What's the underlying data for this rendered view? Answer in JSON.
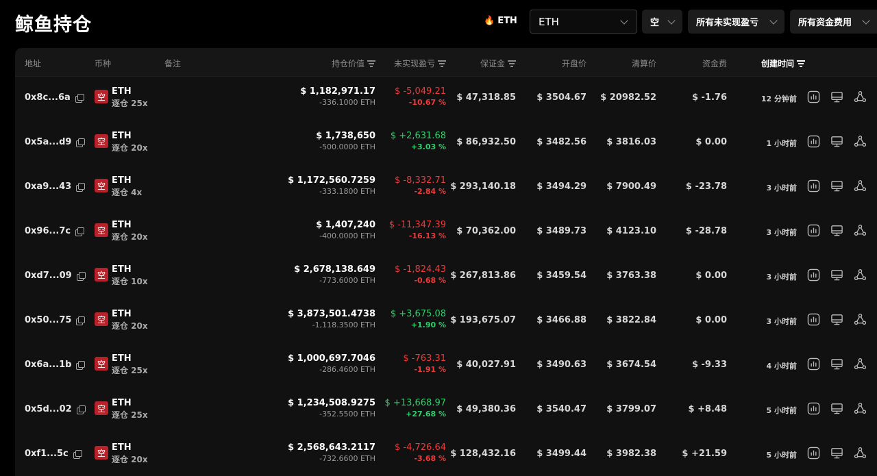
{
  "header": {
    "title": "鲸鱼持仓",
    "hot_label": "ETH",
    "coin_select_value": "ETH",
    "direction_filter": "空",
    "pnl_filter": "所有未实现盈亏",
    "funding_filter": "所有资金费用"
  },
  "columns": {
    "address": "地址",
    "coin": "币种",
    "note": "备注",
    "position_value": "持仓价值",
    "unrealized_pnl": "未实现盈亏",
    "margin": "保证金",
    "open_price": "开盘价",
    "liq_price": "清算价",
    "funding": "资金费",
    "created": "创建时间"
  },
  "side_badge": "空",
  "rows": [
    {
      "address": "0x8c...6a",
      "coin": "ETH",
      "leverage": "逐仓 25x",
      "value": "$ 1,182,971.17",
      "size": "-336.1000 ETH",
      "pnl": "$ -5,049.21",
      "pnl_pct": "-10.67 %",
      "pnl_sign": "neg",
      "margin": "$ 47,318.85",
      "open": "$ 3504.67",
      "liq": "$ 20982.52",
      "funding": "$ -1.76",
      "funding_sign": "neg",
      "time": "12 分钟前"
    },
    {
      "address": "0x5a...d9",
      "coin": "ETH",
      "leverage": "逐仓 20x",
      "value": "$ 1,738,650",
      "size": "-500.0000 ETH",
      "pnl": "$ +2,631.68",
      "pnl_pct": "+3.03 %",
      "pnl_sign": "pos",
      "margin": "$ 86,932.50",
      "open": "$ 3482.56",
      "liq": "$ 3816.03",
      "funding": "$ 0.00",
      "funding_sign": "zero",
      "time": "1 小时前"
    },
    {
      "address": "0xa9...43",
      "coin": "ETH",
      "leverage": "逐仓 4x",
      "value": "$ 1,172,560.7259",
      "size": "-333.1800 ETH",
      "pnl": "$ -8,332.71",
      "pnl_pct": "-2.84 %",
      "pnl_sign": "neg",
      "margin": "$ 293,140.18",
      "open": "$ 3494.29",
      "liq": "$ 7900.49",
      "funding": "$ -23.78",
      "funding_sign": "neg",
      "time": "3 小时前"
    },
    {
      "address": "0x96...7c",
      "coin": "ETH",
      "leverage": "逐仓 20x",
      "value": "$ 1,407,240",
      "size": "-400.0000 ETH",
      "pnl": "$ -11,347.39",
      "pnl_pct": "-16.13 %",
      "pnl_sign": "neg",
      "margin": "$ 70,362.00",
      "open": "$ 3489.73",
      "liq": "$ 4123.10",
      "funding": "$ -28.78",
      "funding_sign": "neg",
      "time": "3 小时前"
    },
    {
      "address": "0xd7...09",
      "coin": "ETH",
      "leverage": "逐仓 10x",
      "value": "$ 2,678,138.649",
      "size": "-773.6000 ETH",
      "pnl": "$ -1,824.43",
      "pnl_pct": "-0.68 %",
      "pnl_sign": "neg",
      "margin": "$ 267,813.86",
      "open": "$ 3459.54",
      "liq": "$ 3763.38",
      "funding": "$ 0.00",
      "funding_sign": "zero",
      "time": "3 小时前"
    },
    {
      "address": "0x50...75",
      "coin": "ETH",
      "leverage": "逐仓 20x",
      "value": "$ 3,873,501.4738",
      "size": "-1,118.3500 ETH",
      "pnl": "$ +3,675.08",
      "pnl_pct": "+1.90 %",
      "pnl_sign": "pos",
      "margin": "$ 193,675.07",
      "open": "$ 3466.88",
      "liq": "$ 3822.84",
      "funding": "$ 0.00",
      "funding_sign": "zero",
      "time": "3 小时前"
    },
    {
      "address": "0x6a...1b",
      "coin": "ETH",
      "leverage": "逐仓 25x",
      "value": "$ 1,000,697.7046",
      "size": "-286.4600 ETH",
      "pnl": "$ -763.31",
      "pnl_pct": "-1.91 %",
      "pnl_sign": "neg",
      "margin": "$ 40,027.91",
      "open": "$ 3490.63",
      "liq": "$ 3674.54",
      "funding": "$ -9.33",
      "funding_sign": "neg",
      "time": "4 小时前"
    },
    {
      "address": "0x5d...02",
      "coin": "ETH",
      "leverage": "逐仓 25x",
      "value": "$ 1,234,508.9275",
      "size": "-352.5500 ETH",
      "pnl": "$ +13,668.97",
      "pnl_pct": "+27.68 %",
      "pnl_sign": "pos",
      "margin": "$ 49,380.36",
      "open": "$ 3540.47",
      "liq": "$ 3799.07",
      "funding": "$ +8.48",
      "funding_sign": "pos",
      "time": "5 小时前"
    },
    {
      "address": "0xf1...5c",
      "coin": "ETH",
      "leverage": "逐仓 20x",
      "value": "$ 2,568,643.2117",
      "size": "-732.6600 ETH",
      "pnl": "$ -4,726.64",
      "pnl_pct": "-3.68 %",
      "pnl_sign": "neg",
      "margin": "$ 128,432.16",
      "open": "$ 3499.44",
      "liq": "$ 3982.38",
      "funding": "$ +21.59",
      "funding_sign": "pos",
      "time": "5 小时前"
    }
  ],
  "row_action_icons": [
    "chart-icon",
    "monitor-icon",
    "share-icon"
  ],
  "colors": {
    "negative": "#f03a3a",
    "positive": "#2fd06b",
    "badge": "#b8222b",
    "hot": "#ff7a1a"
  }
}
